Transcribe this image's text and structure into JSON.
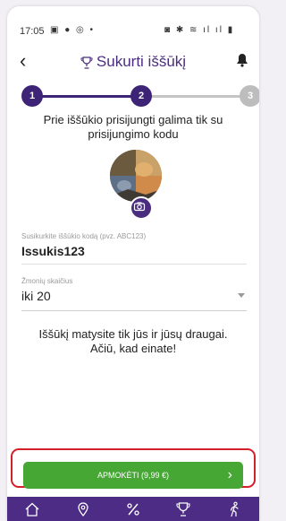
{
  "status_bar": {
    "time": "17:05"
  },
  "header": {
    "title": "Sukurti iššūkį"
  },
  "stepper": {
    "steps": [
      "1",
      "2",
      "3"
    ],
    "current_step": 2
  },
  "info_text": "Prie iššūkio prisijungti galima tik su prisijungimo kodu",
  "code_field": {
    "label": "Susikurkite iššūkio kodą (pvz. ABC123)",
    "value": "Issukis123"
  },
  "people_field": {
    "label": "Žmonių skaičius",
    "value": "iki 20"
  },
  "visibility_text": "Iššūkį matysite tik jūs ir jūsų draugai. Ačiū, kad einate!",
  "cta": {
    "label": "APMOKĖTI (9,99 €)"
  },
  "nav": {
    "items": [
      "home-icon",
      "location-icon",
      "percent-icon",
      "trophy-icon",
      "walking-icon"
    ],
    "active": "walking-icon"
  },
  "colors": {
    "primary": "#4d2c85",
    "success": "#46a735",
    "highlight": "#d3202b"
  }
}
